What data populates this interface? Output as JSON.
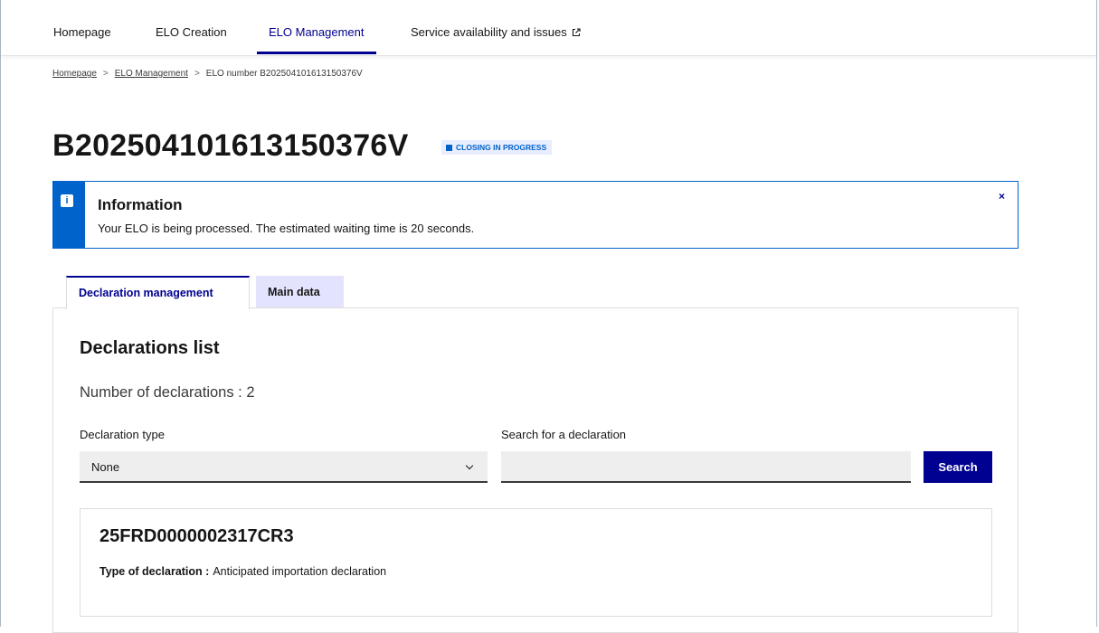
{
  "nav": {
    "items": [
      {
        "label": "Homepage"
      },
      {
        "label": "ELO Creation"
      },
      {
        "label": "ELO Management"
      },
      {
        "label": "Service availability and issues"
      }
    ]
  },
  "breadcrumb": {
    "items": [
      "Homepage",
      "ELO Management",
      "ELO number B202504101613150376V"
    ],
    "separator": ">"
  },
  "page": {
    "title": "B202504101613150376V",
    "status_badge": "CLOSING IN PROGRESS"
  },
  "alert": {
    "icon": "info-icon",
    "title": "Information",
    "text": "Your ELO is being processed. The estimated waiting time is 20 seconds.",
    "close_label": "×"
  },
  "tabs": [
    {
      "label": "Declaration management",
      "active": true
    },
    {
      "label": "Main data",
      "active": false
    }
  ],
  "panel": {
    "title": "Declarations list",
    "count_text": "Number of declarations : 2",
    "type_label": "Declaration type",
    "type_value": "None",
    "search_label": "Search for a declaration",
    "search_value": "",
    "search_button": "Search"
  },
  "declarations": [
    {
      "number": "25FRD0000002317CR3",
      "type_label": "Type of declaration :",
      "type_value": "Anticipated importation declaration"
    }
  ],
  "colors": {
    "primary": "#000091",
    "info": "#0063cb",
    "badge_bg": "#e8edff",
    "inactive_tab_bg": "#e3e3fd"
  }
}
